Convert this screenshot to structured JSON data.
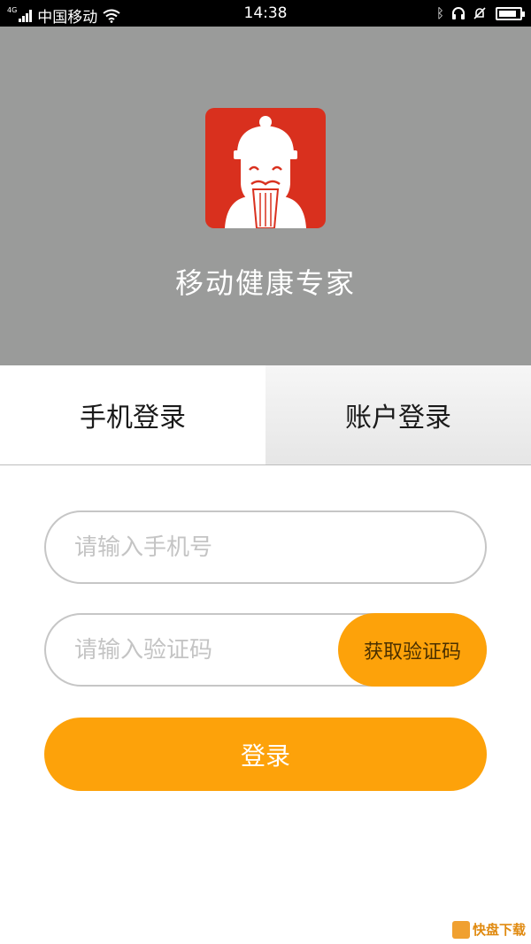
{
  "status_bar": {
    "network": "4G",
    "carrier": "中国移动",
    "time": "14:38",
    "battery_level": 0.85,
    "icons": [
      "signal-icon",
      "wifi-icon",
      "bluetooth-icon",
      "headset-icon",
      "mute-bell-icon",
      "battery-icon"
    ]
  },
  "header": {
    "app_name": "移动健康专家",
    "logo_icon": "elder-doctor-logo",
    "logo_color": "#d9301e",
    "background": "#9a9b9a"
  },
  "tabs": {
    "phone_login": "手机登录",
    "account_login": "账户登录",
    "active": "phone_login"
  },
  "form": {
    "phone_placeholder": "请输入手机号",
    "code_placeholder": "请输入验证码",
    "get_code_label": "获取验证码",
    "login_label": "登录",
    "accent": "#fda20a"
  },
  "watermark": {
    "title": "快盘下载"
  }
}
